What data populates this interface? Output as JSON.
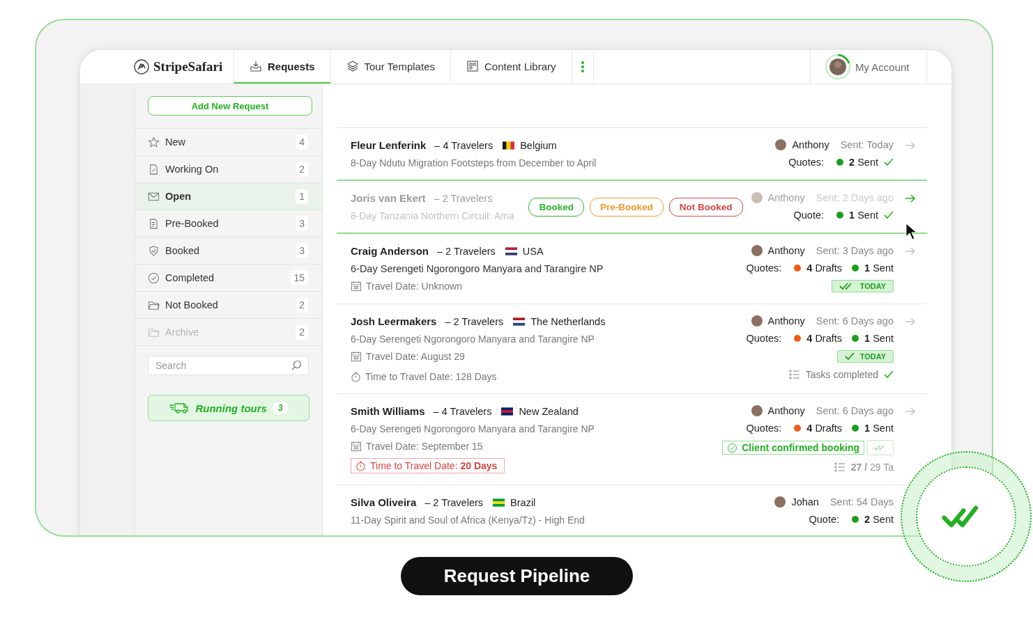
{
  "app": {
    "logo": "StripeSafari",
    "tabs": [
      {
        "kind": "inbox",
        "label": "Requests",
        "selected": true
      },
      {
        "kind": "layers",
        "label": "Tour Templates",
        "selected": false
      },
      {
        "kind": "grid",
        "label": "Content Library",
        "selected": false
      }
    ],
    "account": "My Account"
  },
  "sidebar": {
    "add_button": "Add New Request",
    "items": [
      {
        "kind": "star",
        "label": "New",
        "count": "4",
        "selected": false,
        "disabled": false
      },
      {
        "kind": "doc",
        "label": "Working On",
        "count": "2",
        "selected": false,
        "disabled": false
      },
      {
        "kind": "mail",
        "label": "Open",
        "count": "1",
        "selected": true,
        "disabled": false
      },
      {
        "kind": "list",
        "label": "Pre-Booked",
        "count": "3",
        "selected": false,
        "disabled": false
      },
      {
        "kind": "shield",
        "label": "Booked",
        "count": "3",
        "selected": false,
        "disabled": false
      },
      {
        "kind": "check",
        "label": "Completed",
        "count": "15",
        "selected": false,
        "disabled": false
      },
      {
        "kind": "folder",
        "label": "Not Booked",
        "count": "2",
        "selected": false,
        "disabled": false
      },
      {
        "kind": "folder",
        "label": "Archive",
        "count": "2",
        "selected": false,
        "disabled": true
      }
    ],
    "search": {
      "placeholder": "Search"
    },
    "running_tours": {
      "label": "Running tours",
      "count": "3"
    }
  },
  "requests": [
    {
      "name": "Fleur Lenferink",
      "travelers": "– 4 Travelers",
      "country": "Belgium",
      "trip": "8-Day Ndutu Migration Footsteps from December to April",
      "trip_dark": false,
      "agent": "Anthony",
      "sent": "Sent: Today",
      "quotes_label": "Quotes:",
      "quotes": [
        {
          "count": "2",
          "label": "Sent",
          "color": "#1e9e1e"
        }
      ],
      "quotes_check": true,
      "arrow_active": false,
      "selected": false,
      "faded": false
    },
    {
      "name": "Joris van Ekert",
      "travelers": "– 2 Travelers",
      "trip": "8-Day Tanzania Northern Circuit: Ama",
      "trip_dark": false,
      "status_tags": [
        {
          "label": "Booked",
          "color": "#2bb52b"
        },
        {
          "label": "Pre-Booked",
          "color": "#ee9a2a"
        },
        {
          "label": "Not Booked",
          "color": "#d64545"
        }
      ],
      "agent": "Anthony",
      "sent": "Sent: 2 Days ago",
      "quotes_label": "Quote:",
      "quotes": [
        {
          "count": "1",
          "label": "Sent",
          "color": "#1e9e1e"
        }
      ],
      "quotes_check": true,
      "arrow_active": true,
      "selected": true,
      "faded": true
    },
    {
      "name": "Craig Anderson",
      "travelers": "– 2 Travelers",
      "country": "USA",
      "trip": "6-Day Serengeti Ngorongoro Manyara and Tarangire NP",
      "trip_dark": true,
      "travel_date": "Travel Date: Unknown",
      "agent": "Anthony",
      "sent": "Sent: 3 Days ago",
      "quotes_label": "Quotes:",
      "quotes": [
        {
          "count": "4",
          "label": "Drafts",
          "color": "#f05a14"
        },
        {
          "count": "1",
          "label": "Sent",
          "color": "#1e9e1e"
        }
      ],
      "quotes_check": false,
      "badge": {
        "kind": "double",
        "label": "TODAY"
      },
      "arrow_active": false,
      "selected": false,
      "faded": false
    },
    {
      "name": "Josh Leermakers",
      "travelers": "– 2 Travelers",
      "country": "The Netherlands",
      "trip": "6-Day Serengeti Ngorongoro Manyara and Tarangire NP",
      "trip_dark": false,
      "travel_date": "Travel Date: August 29",
      "time_to_travel": {
        "text": "Time to Travel Date: 128 Days",
        "urgent": false
      },
      "agent": "Anthony",
      "sent": "Sent: 6 Days ago",
      "quotes_label": "Quotes:",
      "quotes": [
        {
          "count": "4",
          "label": "Drafts",
          "color": "#f05a14"
        },
        {
          "count": "1",
          "label": "Sent",
          "color": "#1e9e1e"
        }
      ],
      "quotes_check": false,
      "badge": {
        "kind": "single",
        "label": "TODAY"
      },
      "tasks": {
        "text": "Tasks completed",
        "done": true
      },
      "arrow_active": false,
      "selected": false,
      "faded": false
    },
    {
      "name": "Smith Williams",
      "travelers": "– 4 Travelers",
      "country": "New Zealand",
      "trip": "6-Day Serengeti Ngorongoro Manyara and Tarangire NP",
      "trip_dark": false,
      "travel_date": "Travel Date: September 15",
      "time_to_travel": {
        "text": "Time to Travel Date: **20 Days**",
        "urgent": true
      },
      "agent": "Anthony",
      "sent": "Sent: 6 Days ago",
      "quotes_label": "Quotes:",
      "quotes": [
        {
          "count": "4",
          "label": "Drafts",
          "color": "#f05a14"
        },
        {
          "count": "1",
          "label": "Sent",
          "color": "#1e9e1e"
        }
      ],
      "quotes_check": false,
      "confirmation": "Client confirmed booking",
      "tasks": {
        "text": "**27 /** 29 Ta",
        "done": false
      },
      "arrow_active": false,
      "selected": false,
      "faded": false
    },
    {
      "name": "Silva Oliveira",
      "travelers": "– 2 Travelers",
      "country": "Brazil",
      "trip": "11-Day Spirit and Soul of Africa (Kenya/Tz) - High End",
      "trip_dark": false,
      "agent": "Johan",
      "sent": "Sent: 54 Days",
      "quotes_label": "Quote:",
      "quotes": [
        {
          "count": "2",
          "label": "Sent",
          "color": "#1e9e1e"
        }
      ],
      "quotes_check": false,
      "selected": false,
      "faded": false
    }
  ],
  "caption": "Request Pipeline"
}
